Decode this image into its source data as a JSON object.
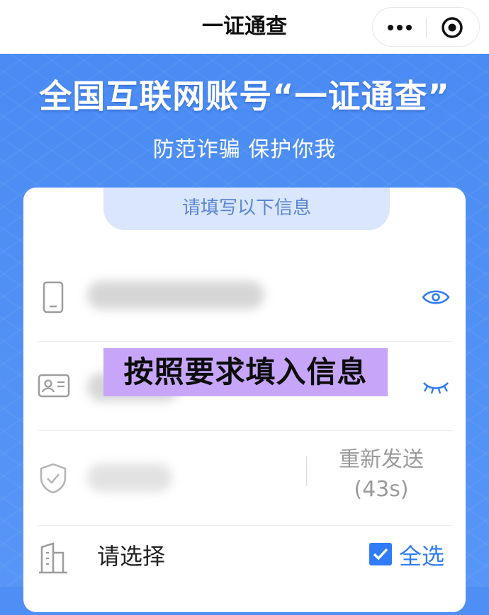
{
  "navbar": {
    "title": "一证通查",
    "more_icon": "more-dots-icon",
    "close_icon": "target-close-icon"
  },
  "hero": {
    "title": "全国互联网账号“一证通查”",
    "subtitle": "防范诈骗 保护你我"
  },
  "form": {
    "header": "请填写以下信息",
    "fields": [
      {
        "icon": "phone-icon",
        "value_masked": true,
        "toggle_icon": "eye-open-icon"
      },
      {
        "icon": "id-card-icon",
        "value_masked": true,
        "toggle_icon": "eye-closed-icon"
      },
      {
        "icon": "shield-check-icon",
        "value_masked": true,
        "resend_label": "重新发送",
        "resend_countdown": "(43s)"
      }
    ],
    "select": {
      "icon": "building-icon",
      "label": "请选择",
      "select_all_label": "全选",
      "select_all_checked": true
    }
  },
  "overlay_caption": "按照要求填入信息",
  "colors": {
    "brand_blue": "#4f8ef5",
    "accent_blue": "#2f7cf6",
    "tab_bg": "#d9e6fc",
    "caption_bg": "#c7a6fa"
  }
}
